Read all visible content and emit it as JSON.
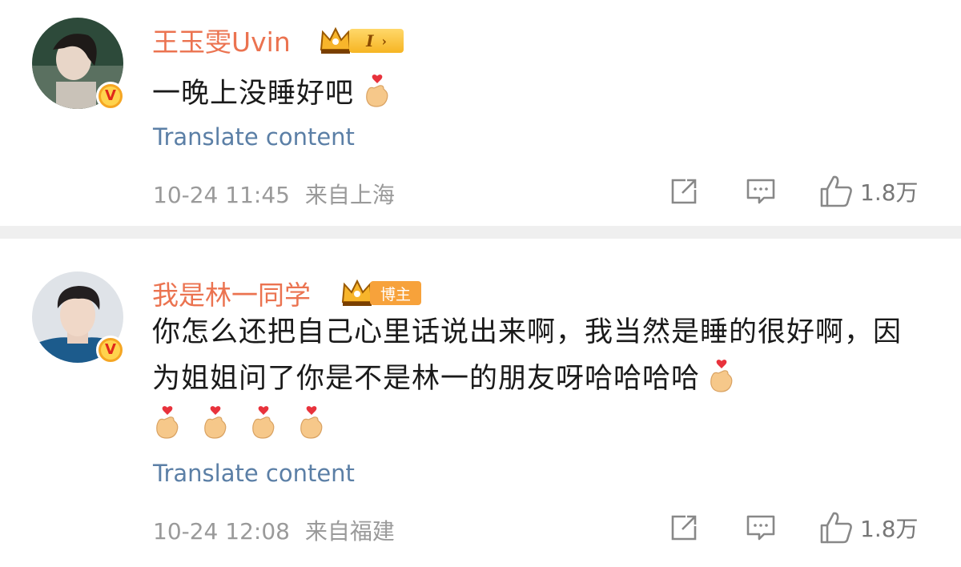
{
  "comments": [
    {
      "username": "王玉雯Uvin",
      "badge_label": "I",
      "text": "一晚上没睡好吧",
      "emoji_name": "finger-heart-emoji",
      "translate_label": "Translate content",
      "timestamp": "10-24 11:45",
      "location": "来自上海",
      "like_count": "1.8万"
    },
    {
      "username": "我是林一同学",
      "badge_label": "博主",
      "text": "你怎么还把自己心里话说出来啊，我当然是睡的很好啊，因为姐姐问了你是不是林一的朋友呀哈哈哈哈",
      "emoji_name": "finger-heart-emoji",
      "translate_label": "Translate content",
      "timestamp": "10-24 12:08",
      "location": "来自福建",
      "like_count": "1.8万"
    }
  ],
  "colors": {
    "username": "#eb7350",
    "translate": "#5b7fa6",
    "meta": "#9a9a9a",
    "divider": "#efefef",
    "verified_badge": "#f5a623"
  },
  "icons": [
    "share-icon",
    "comment-icon",
    "like-icon",
    "verified-badge-icon",
    "crown-icon"
  ]
}
